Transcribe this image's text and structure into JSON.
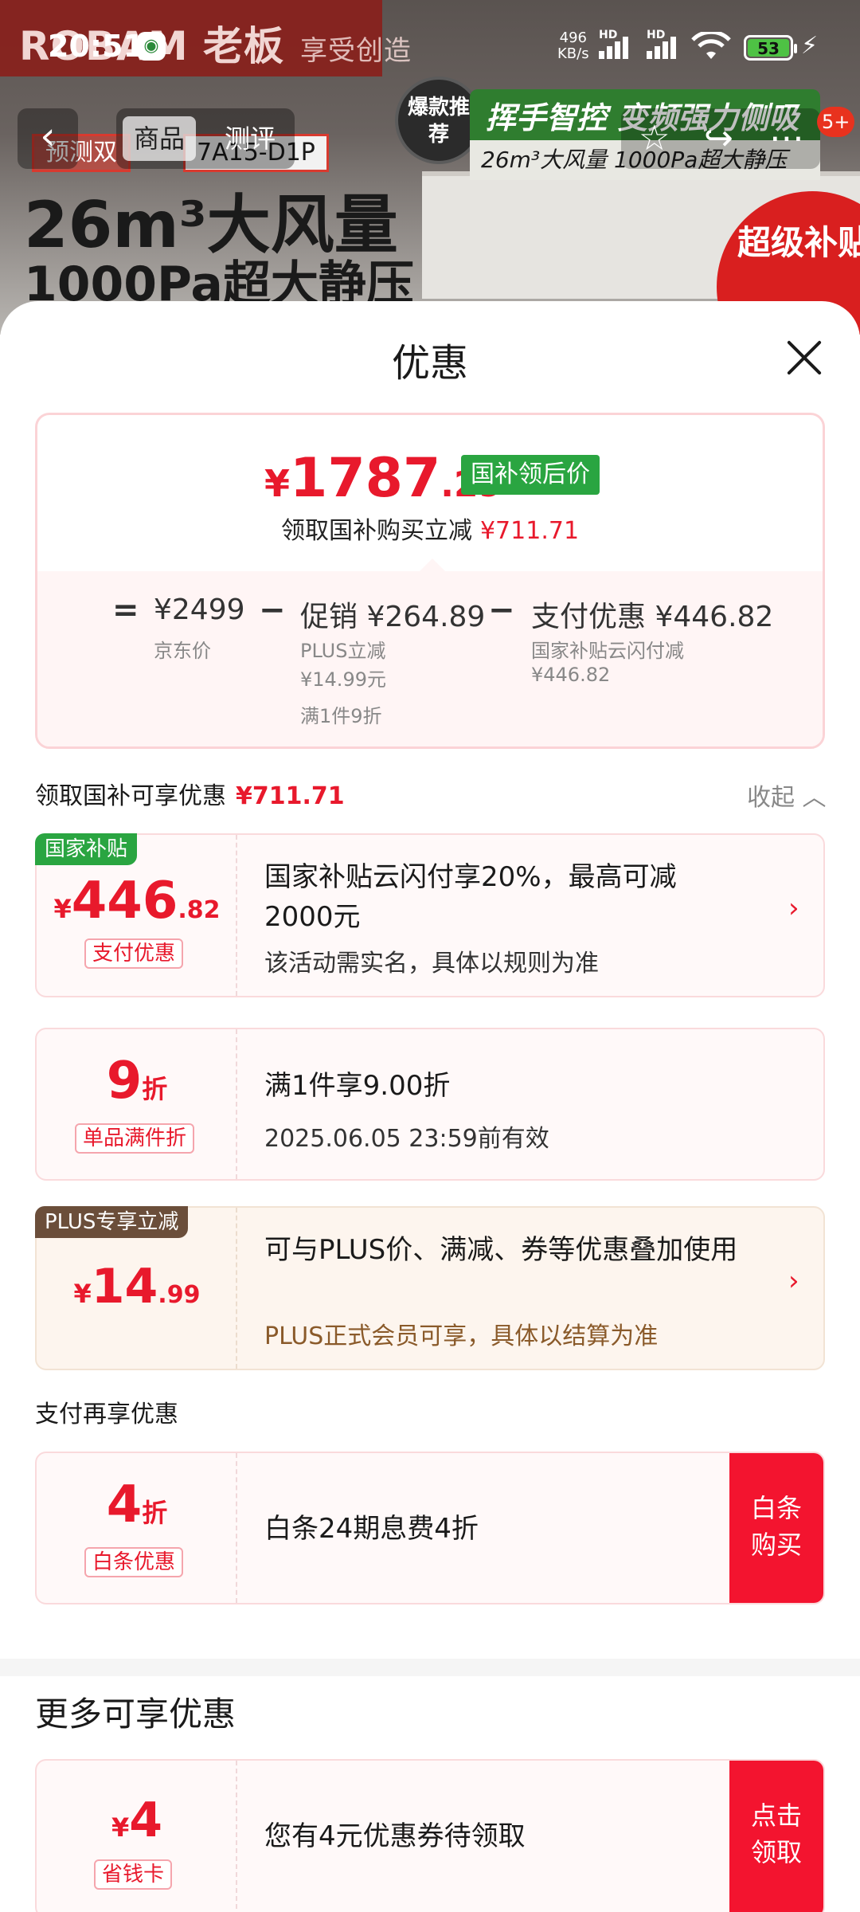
{
  "status_bar": {
    "time": "20:51",
    "net_speed_value": "496",
    "net_speed_unit": "KB/s",
    "hd_1": "HD",
    "hd_2": "HD",
    "battery": "53"
  },
  "background_page": {
    "brand": "ROBAM 老板",
    "slogan": "享受创造",
    "tag_left": "预测双",
    "tag_model": "7A15-D1P",
    "headline_1": "26m³大风量",
    "headline_2": "1000Pa超大静压",
    "promo_circle": "爆款推荐",
    "promo_bar": "挥手智控 变频强力侧吸",
    "promo_sub": "26m³大风量 1000Pa超大静压",
    "subsidy_circle": "超级补贴日",
    "tabs": [
      "商品",
      "测评"
    ],
    "more_badge": "5+"
  },
  "sheet": {
    "title": "优惠",
    "summary": {
      "currency": "¥",
      "price_int": "1787",
      "price_dec": ".29",
      "after_tag": "国补领后价",
      "sub_text": "领取国补购买立减",
      "sub_amount": "¥711.71",
      "eq": "=",
      "jd_price": "¥2499",
      "jd_label": "京东价",
      "minus1": "−",
      "promo_label": "促销",
      "promo_value": "¥264.89",
      "promo_detail_1": "PLUS立减",
      "promo_detail_2": "¥14.99元",
      "promo_detail_3": "满1件9折",
      "minus2": "−",
      "pay_label": "支付优惠",
      "pay_value": "¥446.82",
      "pay_detail_1": "国家补贴云闪付减",
      "pay_detail_2": "¥446.82"
    },
    "section1": {
      "label": "领取国补可享优惠",
      "amount": "¥711.71",
      "collapse": "收起"
    },
    "cards": [
      {
        "top_tag": "国家补贴",
        "amt_cur": "¥",
        "amt_int": "446",
        "amt_dec": ".82",
        "pill": "支付优惠",
        "desc": "国家补贴云闪付享20%，最高可减2000元",
        "note": "该活动需实名，具体以规则为准",
        "chevron": "›"
      },
      {
        "amt_int": "9",
        "amt_unit": "折",
        "pill": "单品满件折",
        "desc": "满1件享9.00折",
        "note": "2025.06.05 23:59前有效"
      },
      {
        "top_tag": "PLUS专享立减",
        "amt_cur": "¥",
        "amt_int": "14",
        "amt_dec": ".99",
        "desc": "可与PLUS价、满减、券等优惠叠加使用",
        "note": "PLUS正式会员可享，具体以结算为准",
        "chevron": "›"
      }
    ],
    "section2": {
      "label": "支付再享优惠"
    },
    "baitiao_card": {
      "amt_int": "4",
      "amt_unit": "折",
      "pill": "白条优惠",
      "desc": "白条24期息费4折",
      "button": "白条购买"
    },
    "more_title": "更多可享优惠",
    "coupon_card": {
      "amt_cur": "¥",
      "amt_int": "4",
      "pill": "省钱卡",
      "desc": "您有4元优惠券待领取",
      "button": "点击领取"
    }
  }
}
